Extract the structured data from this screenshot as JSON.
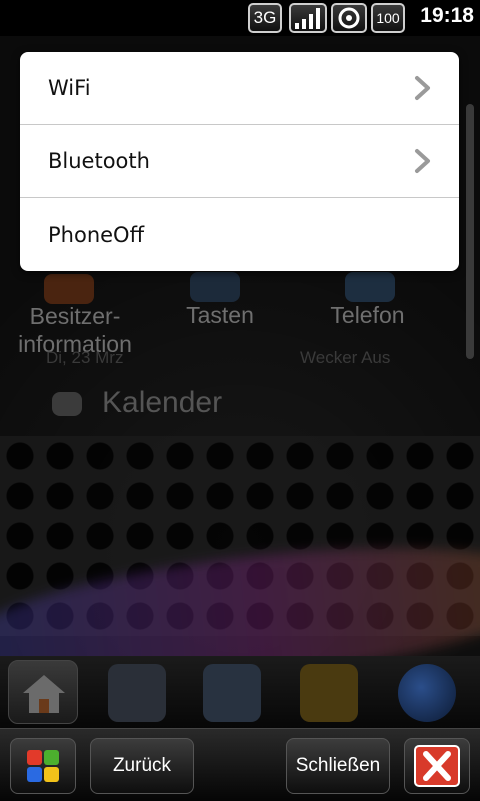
{
  "status_bar": {
    "network": "3G",
    "battery": "100",
    "time": "19:18"
  },
  "background": {
    "apps": [
      {
        "label": "Besitzer-\ninformation"
      },
      {
        "label": "Tasten"
      },
      {
        "label": "Telefon"
      }
    ],
    "calendar_label": "Kalender",
    "date_text": "Di, 23 Mrz",
    "alarm_text": "Wecker Aus"
  },
  "menu": {
    "items": [
      {
        "label": "WiFi",
        "has_submenu": true
      },
      {
        "label": "Bluetooth",
        "has_submenu": true
      },
      {
        "label": "PhoneOff",
        "has_submenu": false
      }
    ]
  },
  "bottom_bar": {
    "start_icon": "windows-start-icon",
    "back_label": "Zurück",
    "close_label": "Schließen",
    "close_icon": "red-x-icon"
  },
  "colors": {
    "menu_bg": "#ffffff",
    "menu_text": "#111111",
    "close_red": "#d83a2a"
  }
}
